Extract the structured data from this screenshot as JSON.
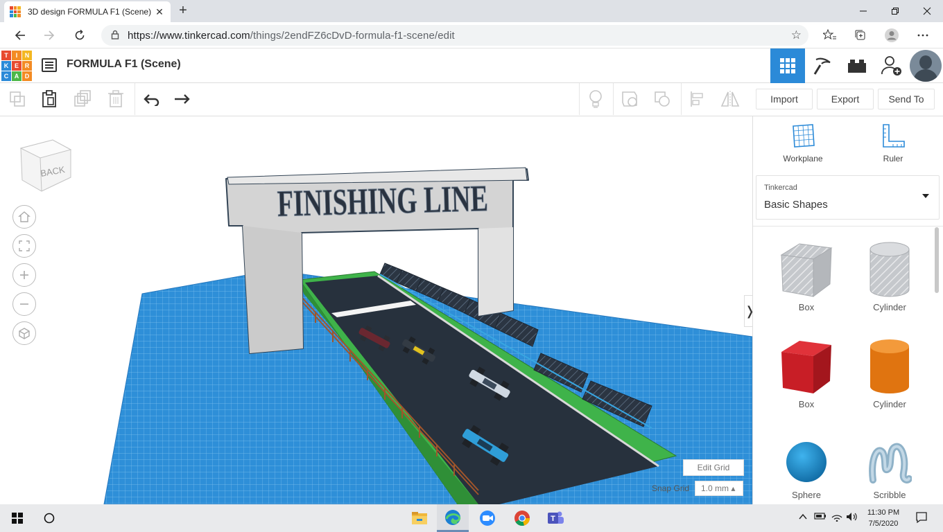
{
  "browser": {
    "tab_title": "3D design FORMULA F1 (Scene)",
    "tab_close": "✕",
    "new_tab": "+",
    "url_host": "https://www.tinkercad.com",
    "url_path": "/things/2endFZ6cDvD-formula-f1-scene/edit"
  },
  "app": {
    "logo_letters": [
      "T",
      "I",
      "N",
      "K",
      "E",
      "R",
      "C",
      "A",
      "D"
    ],
    "logo_colors": [
      "#e84a2f",
      "#f38b24",
      "#f3b721",
      "#2b8ad8",
      "#e84a2f",
      "#f38b24",
      "#2b8ad8",
      "#4db848",
      "#f38b24"
    ],
    "design_title": "FORMULA F1 (Scene)",
    "accent_color": "#2b8ad8"
  },
  "toolbar": {
    "import_label": "Import",
    "export_label": "Export",
    "send_to_label": "Send To"
  },
  "viewcube": {
    "face_label": "BACK"
  },
  "workspace": {
    "sign_text": "FINISHING LINE",
    "edit_grid_label": "Edit Grid",
    "snap_grid_label": "Snap Grid",
    "snap_grid_value": "1.0 mm ▴",
    "collapse_label": "❭"
  },
  "panel": {
    "workplane_label": "Workplane",
    "ruler_label": "Ruler",
    "library_source": "Tinkercad",
    "library_name": "Basic Shapes",
    "shapes": [
      {
        "label": "Box"
      },
      {
        "label": "Cylinder"
      },
      {
        "label": "Box"
      },
      {
        "label": "Cylinder"
      },
      {
        "label": "Sphere"
      },
      {
        "label": "Scribble"
      }
    ]
  },
  "taskbar": {
    "time": "11:30 PM",
    "date": "7/5/2020"
  }
}
